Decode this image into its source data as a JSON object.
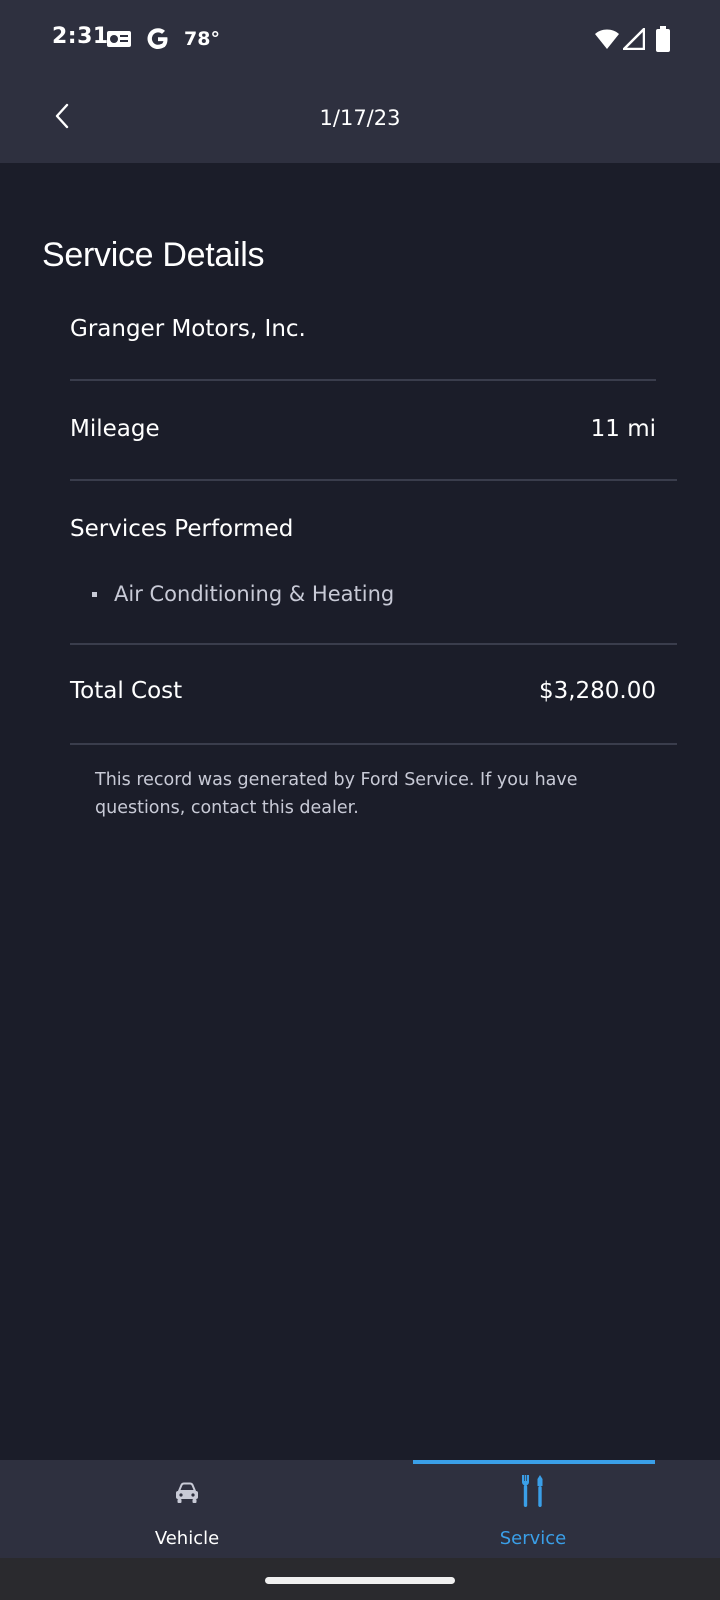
{
  "status_bar": {
    "time": "2:31",
    "temperature": "78°",
    "icons": [
      "notification-card-icon",
      "google-g-icon",
      "wifi-icon",
      "cellular-signal-icon",
      "battery-icon"
    ]
  },
  "header": {
    "title": "1/17/23",
    "back_icon": "chevron-left-icon"
  },
  "page": {
    "title": "Service Details",
    "dealer": "Granger Motors, Inc.",
    "mileage": {
      "label": "Mileage",
      "value": "11 mi"
    },
    "services": {
      "label": "Services Performed",
      "items": [
        "Air Conditioning & Heating"
      ]
    },
    "total_cost": {
      "label": "Total Cost",
      "value": "$3,280.00"
    },
    "footnote": "This record was generated by Ford Service. If you have questions, contact this dealer."
  },
  "bottom_nav": {
    "items": [
      {
        "label": "Vehicle",
        "icon": "car-icon",
        "active": false
      },
      {
        "label": "Service",
        "icon": "tools-icon",
        "active": true
      }
    ]
  },
  "colors": {
    "background": "#1b1d29",
    "header_bg": "#2e303f",
    "accent": "#3a9fe8",
    "divider": "#3a3d4c",
    "secondary_text": "#c8cad6"
  }
}
